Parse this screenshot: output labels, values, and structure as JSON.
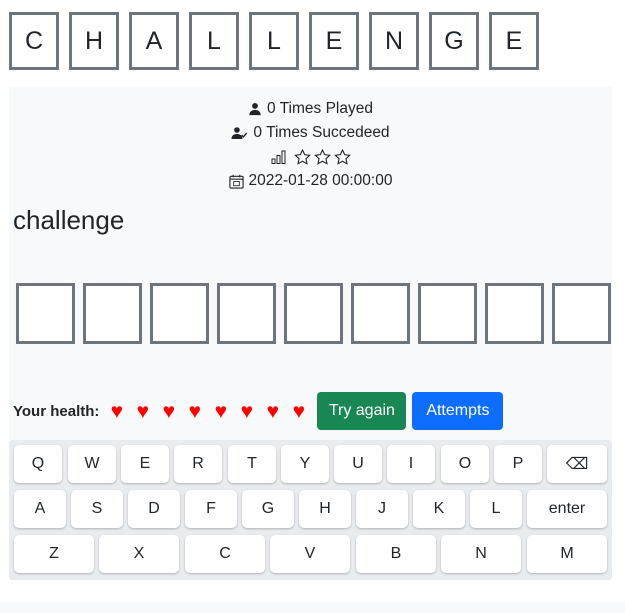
{
  "title_letters": [
    "C",
    "H",
    "A",
    "L",
    "L",
    "E",
    "N",
    "G",
    "E"
  ],
  "stats": {
    "played": "0 Times Played",
    "succeeded": "0 Times Succedeed",
    "difficulty_stars": 3,
    "date": "2022-01-28 00:00:00"
  },
  "word": "challenge",
  "guess_slots": 9,
  "health": {
    "label": "Your health:",
    "hearts": 8,
    "heart_color": "#ff0000"
  },
  "buttons": {
    "try_again": "Try again",
    "attempts": "Attempts"
  },
  "keyboard": {
    "row1": [
      "Q",
      "W",
      "E",
      "R",
      "T",
      "Y",
      "U",
      "I",
      "O",
      "P",
      "⌫"
    ],
    "row2": [
      "A",
      "S",
      "D",
      "F",
      "G",
      "H",
      "J",
      "K",
      "L",
      "enter"
    ],
    "row3": [
      "Z",
      "X",
      "C",
      "V",
      "B",
      "N",
      "M"
    ]
  },
  "colors": {
    "tile_border": "#6c757d",
    "panel_bg": "#f8f9fa",
    "keyboard_bg": "#e9ecef",
    "success": "#198754",
    "primary": "#0d6efd"
  }
}
